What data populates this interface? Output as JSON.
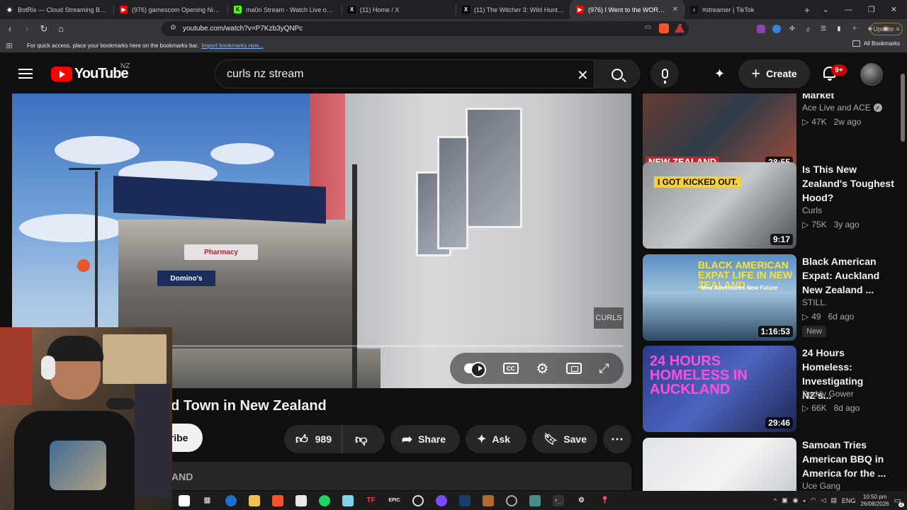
{
  "browser": {
    "tabs": [
      {
        "label": "BotRix — Cloud Streaming Bot for T",
        "fav_color": "#2b2b2b",
        "fav_glyph": "◆"
      },
      {
        "label": "(976) gamescom Opening Night Live",
        "fav_color": "#ff0000",
        "fav_glyph": "▶"
      },
      {
        "label": "ma0ri Stream - Watch Live on Kick",
        "fav_color": "#53fc18",
        "fav_glyph": "K"
      },
      {
        "label": "(11) Home / X",
        "fav_color": "#000000",
        "fav_glyph": "X"
      },
      {
        "label": "(11) The Witcher 3: Wild Hunt Rema",
        "fav_color": "#000000",
        "fav_glyph": "X"
      },
      {
        "label": "(976) I Went to the WORST R",
        "fav_color": "#ff0000",
        "fav_glyph": "▶"
      },
      {
        "label": "#streamer | TikTok",
        "fav_color": "#111111",
        "fav_glyph": "♪"
      }
    ],
    "active_tab_index": 5,
    "url": "youtube.com/watch?v=P7Kzb3yQNPc",
    "update_label": "Update",
    "bookmarks_prompt": "For quick access, place your bookmarks here on the bookmarks bar.",
    "bookmarks_import_link": "Import bookmarks now...",
    "all_bookmarks_label": "All Bookmarks"
  },
  "youtube": {
    "logo_text": "YouTube",
    "country_code": "NZ",
    "search_value": "curls nz stream",
    "create_label": "Create",
    "notifications_badge": "9+",
    "accent_color": "#ff0000"
  },
  "player": {
    "watermark": "CURLS",
    "progress_fraction": 0.0,
    "sign_pharmacy": "Pharmacy",
    "sign_dominos": "Domino's"
  },
  "video": {
    "title_visible": "ed Town in New Zealand",
    "subscribe_label_visible": "cribe",
    "likes": "989",
    "share_label": "Share",
    "ask_label": "Ask",
    "save_label": "Save",
    "description_visible": "AND"
  },
  "recommendations": [
    {
      "title": "Biggest Night Market",
      "title_visible_lines": [
        "Market"
      ],
      "channel": "Ace Live  and ACE",
      "verified": true,
      "views": "47K",
      "age": "2w ago",
      "duration": "28:55",
      "thumb_caption": "NEW ZEALAND",
      "is_new": false
    },
    {
      "title": "Is This New Zealand's Toughest Hood?",
      "title_visible_lines": [
        "Is This New",
        "Zealand's Toughest",
        "Hood?"
      ],
      "channel": "Curls",
      "verified": false,
      "views": "75K",
      "age": "3y ago",
      "duration": "9:17",
      "thumb_caption": "I GOT KICKED OUT.",
      "is_new": false
    },
    {
      "title": "Black American Expat: Auckland New Zealand ...",
      "title_visible_lines": [
        "Black American",
        "Expat: Auckland",
        "New Zealand ..."
      ],
      "channel": "STILL.",
      "verified": false,
      "views": "49",
      "age": "6d ago",
      "duration": "1:16:53",
      "thumb_caption": "BLACK AMERICAN EXPAT LIFE IN NEW ZEALAND",
      "thumb_subcaption": "New Adventures New Future",
      "is_new": true,
      "new_label": "New"
    },
    {
      "title": "24 Hours Homeless: Investigating NZ's...",
      "title_visible_lines": [
        "24 Hours",
        "Homeless:",
        "Investigating NZ's..."
      ],
      "channel": "Paddy Gower",
      "verified": false,
      "views": "66K",
      "age": "8d ago",
      "duration": "29:46",
      "thumb_caption": "24 HOURS HOMELESS IN AUCKLAND",
      "is_new": false
    },
    {
      "title": "Samoan Tries American BBQ in America for the ...",
      "title_visible_lines": [
        "Samoan Tries",
        "American BBQ in",
        "America for the ..."
      ],
      "channel": "Uce Gang",
      "verified": false,
      "is_new": false
    }
  ],
  "taskbar": {
    "language": "ENG",
    "time": "10:50 pm",
    "date": "26/08/2026",
    "notifications": "2"
  }
}
